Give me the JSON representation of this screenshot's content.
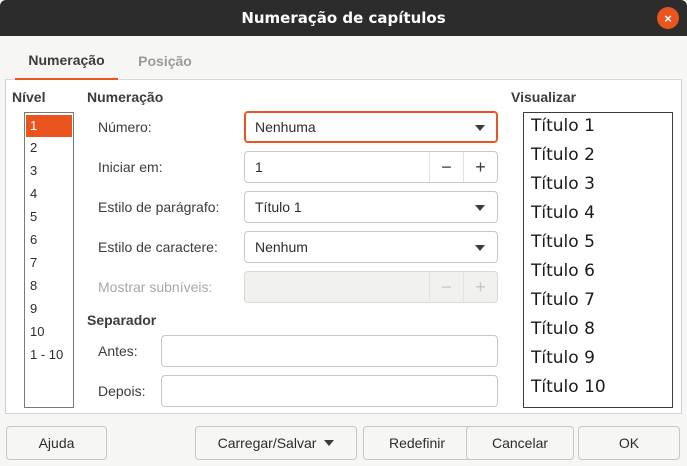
{
  "window": {
    "title": "Numeração de capítulos",
    "close_icon": "×"
  },
  "tabs": [
    {
      "label": "Numeração",
      "active": true
    },
    {
      "label": "Posição",
      "active": false
    }
  ],
  "level": {
    "heading": "Nível",
    "items": [
      "1",
      "2",
      "3",
      "4",
      "5",
      "6",
      "7",
      "8",
      "9",
      "10",
      "1 - 10"
    ],
    "selected_index": 0
  },
  "numbering": {
    "heading": "Numeração",
    "number_label": "Número:",
    "number_value": "Nenhuma",
    "start_label": "Iniciar em:",
    "start_value": "1",
    "paragraph_style_label": "Estilo de parágrafo:",
    "paragraph_style_value": "Título 1",
    "char_style_label": "Estilo de caractere:",
    "char_style_value": "Nenhum",
    "sublevels_label": "Mostrar subníveis:",
    "sublevels_value": "",
    "minus": "−",
    "plus": "+"
  },
  "separator": {
    "heading": "Separador",
    "before_label": "Antes:",
    "before_value": "",
    "after_label": "Depois:",
    "after_value": ""
  },
  "preview": {
    "heading": "Visualizar",
    "lines": [
      "Título 1",
      "Título 2",
      "Título 3",
      "Título 4",
      "Título 5",
      "Título 6",
      "Título 7",
      "Título 8",
      "Título 9",
      "Título 10"
    ]
  },
  "buttons": {
    "help": "Ajuda",
    "load_save": "Carregar/Salvar",
    "reset": "Redefinir",
    "cancel": "Cancelar",
    "ok": "OK"
  },
  "colors": {
    "accent": "#e9541f",
    "titlebar": "#2c2c2c"
  }
}
